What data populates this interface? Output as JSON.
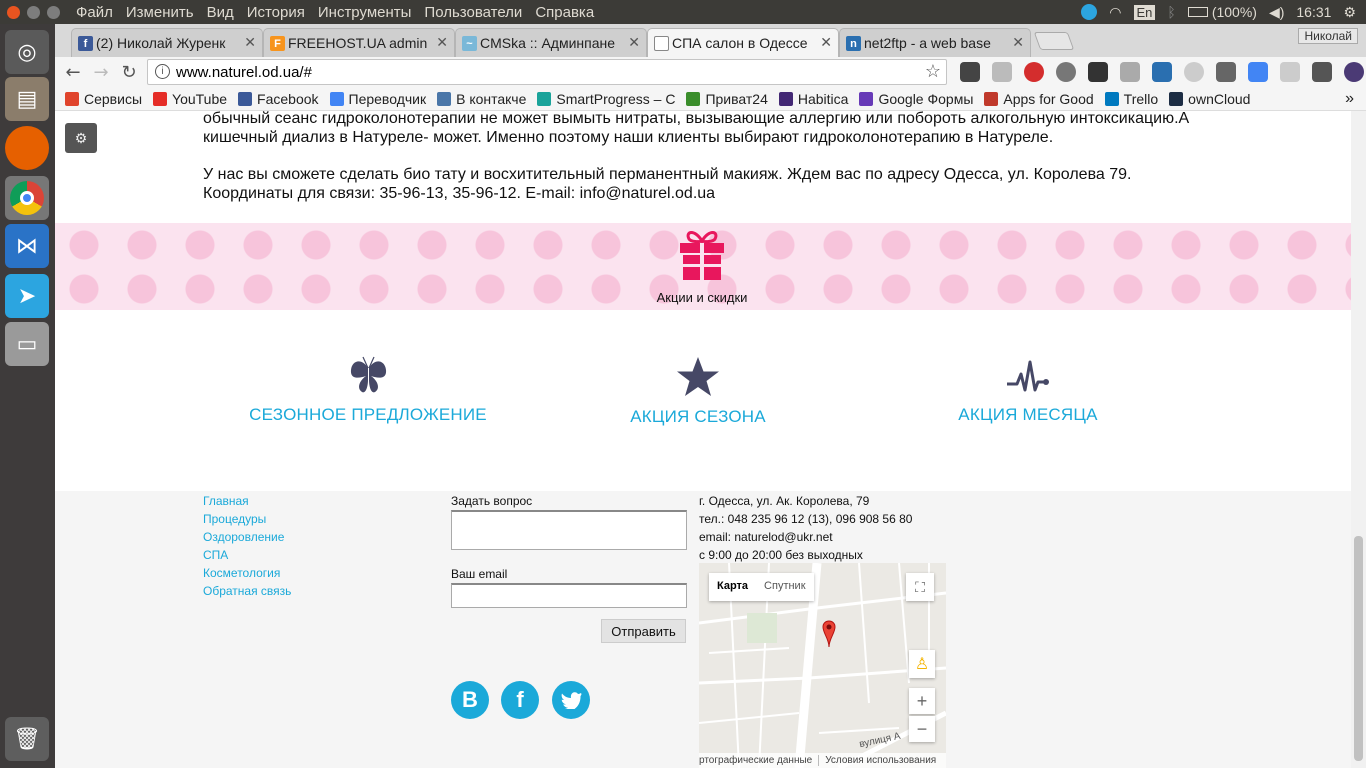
{
  "system": {
    "menu": [
      "Файл",
      "Изменить",
      "Вид",
      "История",
      "Инструменты",
      "Пользователи",
      "Справка"
    ],
    "keyboard_layout": "En",
    "battery": "(100%)",
    "clock": "16:31"
  },
  "launcher": {
    "icons": [
      "ubuntu-dash-icon",
      "files-icon",
      "firefox-icon",
      "chrome-icon",
      "vscode-icon",
      "telegram-icon",
      "drive-icon",
      "trash-icon"
    ]
  },
  "browser": {
    "tabs": [
      {
        "label": "(2) Николай Журенк",
        "favicon_color": "#3b5998",
        "favicon": "f"
      },
      {
        "label": "FREEHOST.UA admin",
        "favicon_color": "#f7941d",
        "favicon": "F"
      },
      {
        "label": "CMSka :: Админпане",
        "favicon_color": "#7ab8d8",
        "favicon": "~"
      },
      {
        "label": "СПА салон в Одессе",
        "favicon_color": "#ffffff",
        "favicon": ""
      },
      {
        "label": "net2ftp - a web base",
        "favicon_color": "#2a6fb0",
        "favicon": "n"
      }
    ],
    "active_tab": 3,
    "user_badge": "Николай",
    "url": "www.naturel.od.ua/#",
    "bookmarks": [
      {
        "label": "Сервисы",
        "color": "#e0442c"
      },
      {
        "label": "YouTube",
        "color": "#e52d27"
      },
      {
        "label": "Facebook",
        "color": "#3b5998"
      },
      {
        "label": "Переводчик",
        "color": "#4285f4"
      },
      {
        "label": "В контакче",
        "color": "#4a76a8"
      },
      {
        "label": "SmartProgress – С",
        "color": "#1aa39a"
      },
      {
        "label": "Приват24",
        "color": "#3a8d2b"
      },
      {
        "label": "Habitica",
        "color": "#432874"
      },
      {
        "label": "Google Формы",
        "color": "#673ab7"
      },
      {
        "label": "Apps for Good",
        "color": "#c0392b"
      },
      {
        "label": "Trello",
        "color": "#0079bf"
      },
      {
        "label": "ownCloud",
        "color": "#1d2d44"
      }
    ],
    "bookmarks_overflow": "»"
  },
  "page": {
    "para1_line1": "обычный сеанс гидроколонотерапии не может вымыть нитраты, вызывающие аллергию или побороть алкогольную интоксикацию.А",
    "para1_line2": "кишечный диализ в Натуреле- может. Именно поэтому наши клиенты выбирают гидроколонотерапию в Натуреле.",
    "para2_line1": "У нас вы сможете сделать био тату и восхитительный перманентный макияж. Ждем вас по адресу Одесса, ул. Королева 79.",
    "para2_line2": "Координаты для связи: 35-96-13, 35-96-12. E-mail: info@naturel.od.ua",
    "gift_label": "Акции и скидки",
    "promos": [
      {
        "title": "СЕЗОННОЕ ПРЕДЛОЖЕНИЕ",
        "icon": "butterfly-icon"
      },
      {
        "title": "АКЦИЯ СЕЗОНА",
        "icon": "star-icon"
      },
      {
        "title": "АКЦИЯ МЕСЯЦА",
        "icon": "pulse-icon"
      }
    ],
    "accent_color": "#1ba9d9",
    "gift_color": "#e8175d"
  },
  "footer": {
    "nav": [
      "Главная",
      "Процедуры",
      "Оздоровление",
      "СПА",
      "Косметология",
      "Обратная связь"
    ],
    "question_label": "Задать вопрос",
    "email_label": "Ваш email",
    "send_label": "Отправить",
    "social": [
      "В",
      "f",
      "t"
    ],
    "address": "г. Одесса, ул. Ак. Королева, 79",
    "phone": "тел.: 048 235 96 12 (13), 096 908 56 80",
    "email": "email: naturelod@ukr.net",
    "hours": "с 9:00 до 20:00 без выходных",
    "map": {
      "tab_map": "Карта",
      "tab_satellite": "Спутник",
      "street": "вулиця А",
      "footer_data": "ртографические данные",
      "footer_terms": "Условия использования"
    }
  }
}
